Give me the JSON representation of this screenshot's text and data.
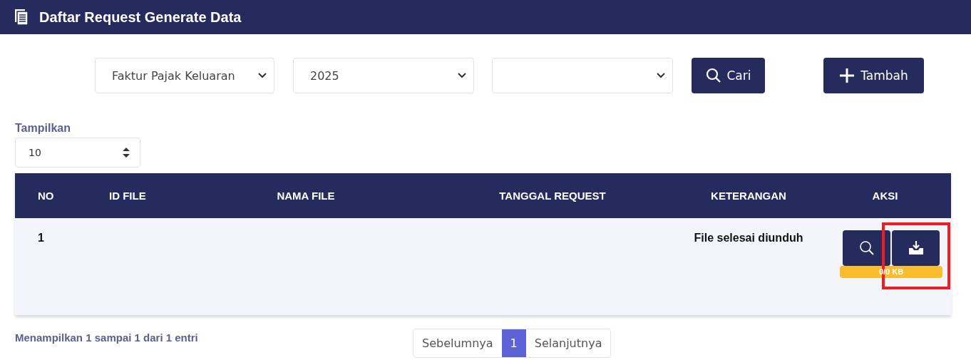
{
  "header": {
    "title": "Daftar Request Generate Data"
  },
  "selects": [
    {
      "kind": "filled",
      "value": "Faktur Pajak Keluaran"
    },
    {
      "kind": "filled",
      "value": "2025"
    },
    {
      "kind": "blank"
    }
  ],
  "buttons": [
    {
      "label": "Cari",
      "kind": "search"
    },
    {
      "label": "Tambah",
      "kind": "add"
    }
  ],
  "page_size": {
    "label": "Tampilkan",
    "value": "10"
  },
  "table": {
    "columns": [
      "NO",
      "ID FILE",
      "NAMA FILE",
      "TANGGAL REQUEST",
      "KETERANGAN",
      "AKSI"
    ],
    "rows": [
      {
        "no": "1",
        "keterangan": "File selesai diunduh",
        "progress": {
          "label": "0/0 KB",
          "level": 1
        }
      }
    ]
  },
  "footer": {
    "info": "Menampilkan 1 sampai 1 dari 1 entri"
  },
  "pagination": {
    "previous": "Sebelumnya",
    "pages": [
      {
        "label": "1",
        "selected": true
      }
    ],
    "next": "Selanjutnya"
  },
  "annotations": [
    {
      "kind": "rectangle"
    }
  ]
}
